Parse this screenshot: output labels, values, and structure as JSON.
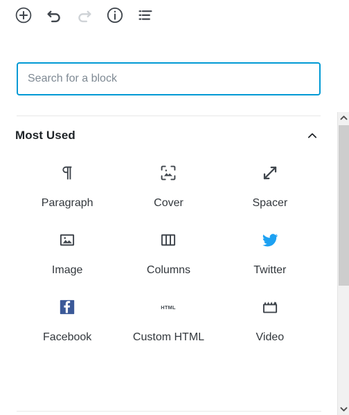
{
  "window": {
    "background_color": "#ffffff",
    "accent_color": "#0099d4"
  },
  "toolbar": {
    "buttons": [
      {
        "name": "add-block-button",
        "icon": "plus-circle-icon",
        "label": "Add block",
        "enabled": true
      },
      {
        "name": "undo-button",
        "icon": "undo-icon",
        "label": "Undo",
        "enabled": true
      },
      {
        "name": "redo-button",
        "icon": "redo-icon",
        "label": "Redo",
        "enabled": false
      },
      {
        "name": "details-button",
        "icon": "info-circle-icon",
        "label": "Details",
        "enabled": true
      },
      {
        "name": "block-navigation-button",
        "icon": "list-view-icon",
        "label": "Block navigation",
        "enabled": true
      }
    ]
  },
  "inserter": {
    "search": {
      "placeholder": "Search for a block",
      "value": ""
    },
    "section": {
      "title": "Most Used",
      "expanded": true,
      "collapse_icon": "chevron-up-icon"
    },
    "blocks": [
      {
        "label": "Paragraph",
        "icon": "paragraph-icon",
        "color": "#40464d"
      },
      {
        "label": "Cover",
        "icon": "cover-icon",
        "color": "#40464d"
      },
      {
        "label": "Spacer",
        "icon": "spacer-icon",
        "color": "#40464d"
      },
      {
        "label": "Image",
        "icon": "image-icon",
        "color": "#40464d"
      },
      {
        "label": "Columns",
        "icon": "columns-icon",
        "color": "#40464d"
      },
      {
        "label": "Twitter",
        "icon": "twitter-icon",
        "color": "#1da1f2"
      },
      {
        "label": "Facebook",
        "icon": "facebook-icon",
        "color": "#3b5998"
      },
      {
        "label": "Custom HTML",
        "icon": "custom-html-icon",
        "color": "#40464d"
      },
      {
        "label": "Video",
        "icon": "video-icon",
        "color": "#40464d"
      }
    ]
  },
  "scrollbar": {
    "up_icon": "chevron-up-icon",
    "down_icon": "chevron-down-icon",
    "orientation": "vertical"
  }
}
